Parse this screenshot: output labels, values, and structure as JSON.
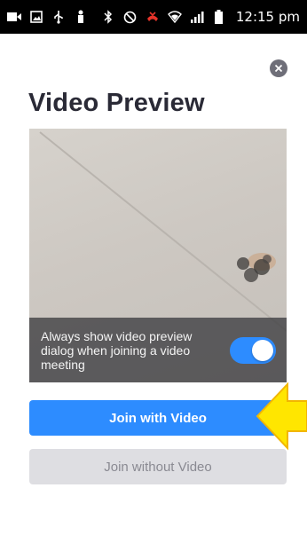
{
  "status_bar": {
    "time": "12:15 pm",
    "icons": [
      "video-call-icon",
      "image-icon",
      "usb-icon",
      "person-icon",
      "bluetooth-icon",
      "do-not-disturb-icon",
      "phone-missed-icon",
      "wifi-icon",
      "signal-icon",
      "battery-icon"
    ]
  },
  "dialog": {
    "title": "Video Preview",
    "close_icon": "close-icon",
    "preview": {
      "option_text": "Always show video preview dialog when joining a video meeting",
      "toggle_on": true
    },
    "join_with_video": "Join with Video",
    "join_without_video": "Join without Video"
  },
  "colors": {
    "accent": "#2d8cff",
    "secondary_button": "#dedee2",
    "arrow": "#ffe600"
  }
}
